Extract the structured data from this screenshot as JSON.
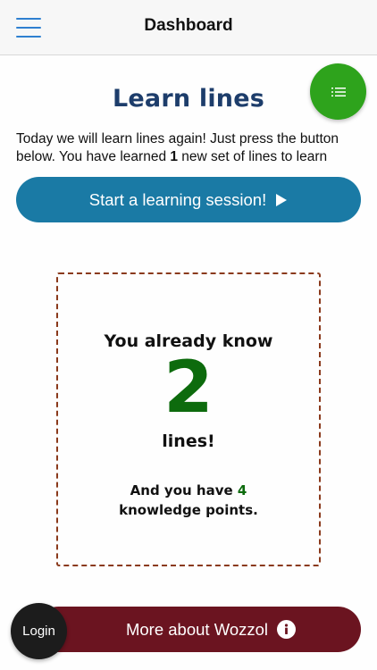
{
  "header": {
    "title": "Dashboard",
    "menu_icon": "hamburger-menu-icon"
  },
  "fab": {
    "icon": "list-icon"
  },
  "main": {
    "heading": "Learn lines",
    "intro_before": "Today we will learn lines again! Just press the button below. You have learned ",
    "intro_count": "1",
    "intro_after": " new set of lines to learn",
    "start_button_label": "Start a learning session!",
    "start_button_icon": "play-icon"
  },
  "stats": {
    "know_prefix": "You already know",
    "lines_count": "2",
    "lines_suffix": "lines!",
    "points_prefix": "And you have ",
    "points_count": "4",
    "points_suffix": "knowledge points."
  },
  "footer": {
    "more_button_label": "More about Wozzol",
    "more_button_icon": "info-icon",
    "login_label": "Login"
  },
  "colors": {
    "accent_blue": "#1a7aa5",
    "heading_navy": "#1d3d6b",
    "fab_green": "#2ea31c",
    "count_green": "#0d6b0d",
    "more_button_maroon": "#6b1420",
    "dashed_border": "#8a3a1c"
  }
}
